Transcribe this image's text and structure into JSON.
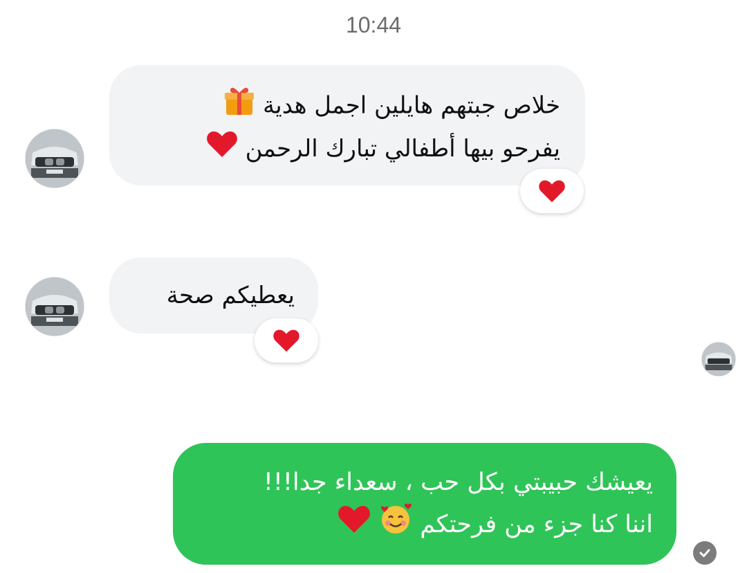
{
  "chat": {
    "timestamp": "10:44",
    "messages": [
      {
        "direction": "incoming",
        "line1": "خلاص جبتهم هايلين اجمل هدية",
        "line2": "يفرحو بيها أطفالي تبارك الرحمن",
        "line1_emoji": "wrapped-gift-icon",
        "line2_emoji": "red-heart-icon",
        "reaction": "red-heart-icon"
      },
      {
        "direction": "incoming",
        "line1": "يعطيكم صحة",
        "reaction": "red-heart-icon"
      },
      {
        "direction": "outgoing",
        "line1": "يعيشك حبيبتي بكل حب ، سعداء جدا!!!",
        "line2": "اننا كنا جزء من فرحتكم",
        "line2_emojis": [
          "smiling-face-with-hearts-icon",
          "red-heart-icon"
        ]
      }
    ],
    "status": "delivered-check-icon",
    "colors": {
      "incoming_bubble": "#f2f3f5",
      "outgoing_bubble": "#2fc458",
      "heart": "#e3192b",
      "timestamp_text": "#6b6b6b"
    }
  }
}
